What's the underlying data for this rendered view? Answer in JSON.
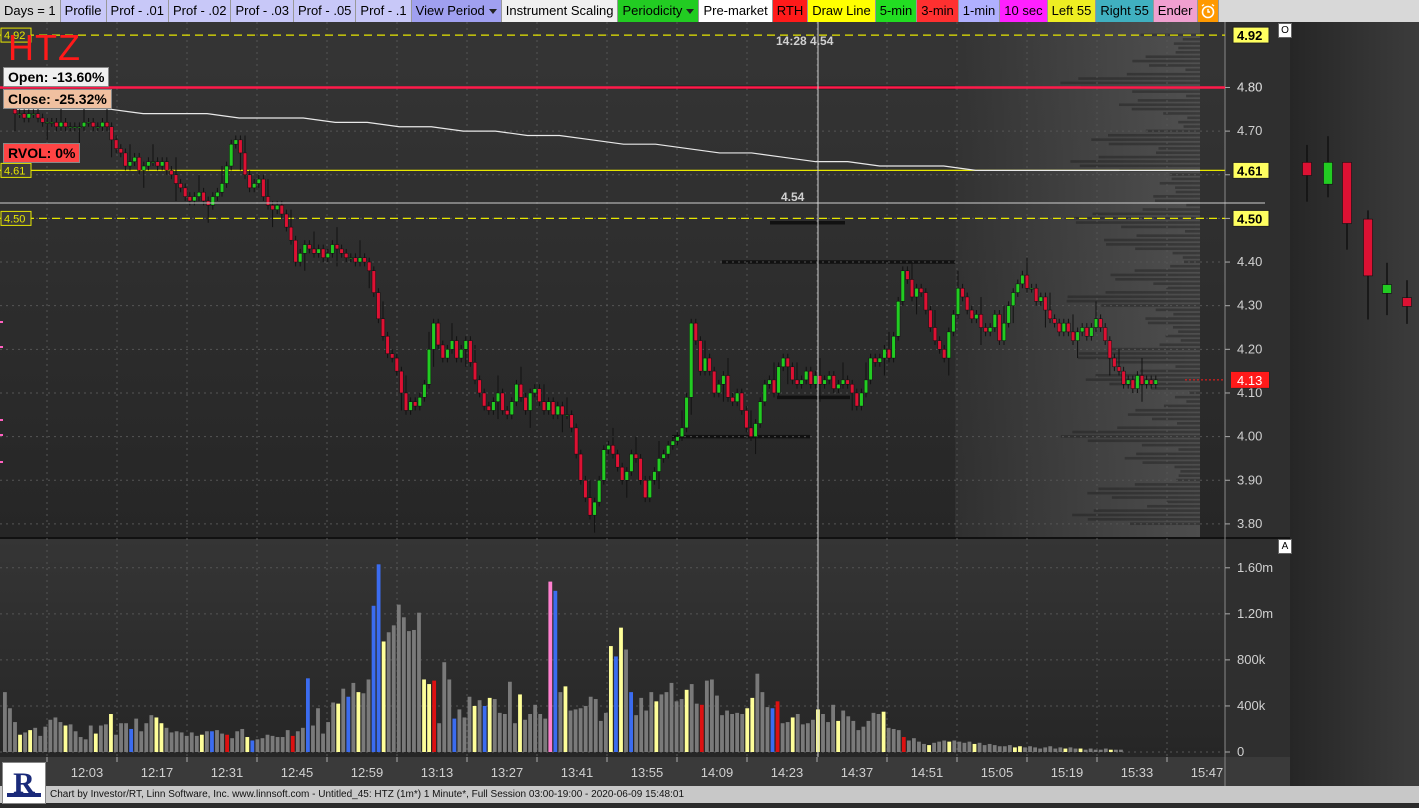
{
  "toolbar": [
    {
      "label": "Days = 1",
      "bg": "#d8d8d8",
      "fg": "#000"
    },
    {
      "label": "Profile",
      "bg": "#c8c8f8",
      "fg": "#000"
    },
    {
      "label": "Prof - .01",
      "bg": "#c8c8f8",
      "fg": "#000"
    },
    {
      "label": "Prof - .02",
      "bg": "#c8c8f8",
      "fg": "#000"
    },
    {
      "label": "Prof - .03",
      "bg": "#c8c8f8",
      "fg": "#000"
    },
    {
      "label": "Prof - .05",
      "bg": "#c8c8f8",
      "fg": "#000"
    },
    {
      "label": "Prof - .1",
      "bg": "#c8c8f8",
      "fg": "#000"
    },
    {
      "label": "View Period",
      "bg": "#a0a0f0",
      "fg": "#000",
      "dropdown": true
    },
    {
      "label": "Instrument Scaling",
      "bg": "#f0f0f0",
      "fg": "#000"
    },
    {
      "label": "Periodicity",
      "bg": "#22cc22",
      "fg": "#000",
      "dropdown": true
    },
    {
      "label": "Pre-market",
      "bg": "#ffffff",
      "fg": "#000"
    },
    {
      "label": "RTH",
      "bg": "#ff1a1a",
      "fg": "#000"
    },
    {
      "label": "Draw Line",
      "bg": "#ffff00",
      "fg": "#000"
    },
    {
      "label": "5-min",
      "bg": "#22dd22",
      "fg": "#000"
    },
    {
      "label": "3-min",
      "bg": "#ff3030",
      "fg": "#000"
    },
    {
      "label": "1-min",
      "bg": "#b0b0ff",
      "fg": "#000"
    },
    {
      "label": "10 sec",
      "bg": "#ff20ff",
      "fg": "#000"
    },
    {
      "label": "Left 55",
      "bg": "#eeee22",
      "fg": "#000"
    },
    {
      "label": "Right 55",
      "bg": "#40b0c0",
      "fg": "#000"
    },
    {
      "label": "Ender",
      "bg": "#f0a0d0",
      "fg": "#000"
    }
  ],
  "symbol": "HTZ",
  "open_label": "Open: -13.60%",
  "close_label": "Close: -25.32%",
  "rvol_label": "RVOL: 0%",
  "crosshair_label": "14:28  4.54",
  "crosshair_price": "4.54",
  "pane_letters": {
    "price": "O",
    "volume": "A"
  },
  "footer": "Chart by Investor/RT, Linn Software, Inc. www.linnsoft.com - Untitled_45: HTZ (1m*) 1 Minute*, Full Session 03:00-19:00 - 2020-06-09 15:48:01",
  "colors": {
    "up": "#22cc22",
    "down": "#dd1133",
    "vol_gray": "#7a7a7a",
    "vol_blue": "#3b6cf0",
    "vol_red": "#dd1111",
    "vol_yellow": "#ffff99",
    "vol_pink": "#ff80d0",
    "hline_red": "#ff1a4a",
    "hline_yellow": "#e6e600",
    "vwap": "#e8e8e8"
  },
  "chart_data": {
    "type": "candlestick",
    "price_axis": {
      "ticks": [
        "4.80",
        "4.70",
        "4.60",
        "4.50",
        "4.40",
        "4.30",
        "4.20",
        "4.10",
        "4.00",
        "3.90",
        "3.80"
      ],
      "range": [
        3.77,
        4.95
      ]
    },
    "volume_axis": {
      "ticks": [
        "1.60m",
        "1.20m",
        "800k",
        "400k",
        "0"
      ],
      "range": [
        0,
        1850000
      ]
    },
    "time_axis": [
      "12:03",
      "12:17",
      "12:31",
      "12:45",
      "12:59",
      "13:13",
      "13:27",
      "13:41",
      "13:55",
      "14:09",
      "14:23",
      "14:37",
      "14:51",
      "15:05",
      "15:19",
      "15:33",
      "15:47"
    ],
    "price_labels": [
      {
        "value": "4.92",
        "color": "#ffff60",
        "style": "dashed"
      },
      {
        "value": "4.80",
        "color": "#ff1a4a",
        "style": "solid"
      },
      {
        "value": "4.61",
        "color": "#ffff60",
        "style": "solid"
      },
      {
        "value": "4.50",
        "color": "#ffff60",
        "style": "dashed"
      },
      {
        "value": "4.13",
        "color": "#ff1a1a",
        "style": "dotted"
      }
    ],
    "left_labels": [
      "4.92",
      "4.61",
      "4.50"
    ],
    "last_price": "4.13",
    "candles_start": "12:03",
    "closes": [
      4.74,
      4.74,
      4.73,
      4.74,
      4.74,
      4.73,
      4.72,
      4.72,
      4.72,
      4.71,
      4.72,
      4.71,
      4.71,
      4.71,
      4.71,
      4.72,
      4.72,
      4.71,
      4.71,
      4.72,
      4.71,
      4.68,
      4.66,
      4.65,
      4.62,
      4.63,
      4.64,
      4.61,
      4.62,
      4.63,
      4.63,
      4.62,
      4.63,
      4.61,
      4.6,
      4.58,
      4.57,
      4.55,
      4.54,
      4.55,
      4.56,
      4.54,
      4.53,
      4.55,
      4.56,
      4.58,
      4.62,
      4.67,
      4.68,
      4.65,
      4.6,
      4.57,
      4.58,
      4.59,
      4.55,
      4.53,
      4.52,
      4.53,
      4.51,
      4.48,
      4.45,
      4.4,
      4.42,
      4.44,
      4.43,
      4.42,
      4.43,
      4.41,
      4.42,
      4.44,
      4.43,
      4.42,
      4.41,
      4.41,
      4.4,
      4.41,
      4.4,
      4.38,
      4.33,
      4.27,
      4.23,
      4.19,
      4.18,
      4.15,
      4.1,
      4.06,
      4.08,
      4.07,
      4.09,
      4.12,
      4.2,
      4.26,
      4.21,
      4.18,
      4.2,
      4.22,
      4.18,
      4.2,
      4.22,
      4.17,
      4.13,
      4.1,
      4.07,
      4.06,
      4.08,
      4.1,
      4.06,
      4.05,
      4.08,
      4.12,
      4.09,
      4.06,
      4.1,
      4.11,
      4.08,
      4.06,
      4.08,
      4.05,
      4.07,
      4.05,
      4.05,
      4.02,
      3.96,
      3.9,
      3.86,
      3.82,
      3.85,
      3.9,
      3.97,
      3.98,
      3.96,
      3.93,
      3.9,
      3.92,
      3.96,
      3.95,
      3.9,
      3.86,
      3.9,
      3.92,
      3.95,
      3.96,
      3.98,
      3.99,
      4.0,
      4.02,
      4.09,
      4.26,
      4.22,
      4.15,
      4.18,
      4.15,
      4.1,
      4.12,
      4.14,
      4.09,
      4.08,
      4.1,
      4.06,
      4.02,
      4.0,
      4.03,
      4.08,
      4.12,
      4.13,
      4.1,
      4.16,
      4.18,
      4.16,
      4.13,
      4.12,
      4.13,
      4.15,
      4.12,
      4.14,
      4.12,
      4.13,
      4.14,
      4.11,
      4.12,
      4.13,
      4.12,
      4.1,
      4.07,
      4.1,
      4.13,
      4.18,
      4.17,
      4.18,
      4.2,
      4.18,
      4.23,
      4.31,
      4.38,
      4.36,
      4.32,
      4.34,
      4.33,
      4.29,
      4.25,
      4.22,
      4.2,
      4.18,
      4.24,
      4.28,
      4.34,
      4.32,
      4.29,
      4.27,
      4.28,
      4.25,
      4.24,
      4.25,
      4.28,
      4.22,
      4.26,
      4.3,
      4.33,
      4.35,
      4.37,
      4.34,
      4.34,
      4.31,
      4.32,
      4.29,
      4.27,
      4.26,
      4.24,
      4.26,
      4.24,
      4.22,
      4.24,
      4.25,
      4.23,
      4.25,
      4.27,
      4.25,
      4.22,
      4.18,
      4.16,
      4.15,
      4.12,
      4.13,
      4.11,
      4.14,
      4.12,
      4.13,
      4.12,
      4.13
    ],
    "vwap": [
      4.75,
      4.75,
      4.75,
      4.75,
      4.74,
      4.74,
      4.74,
      4.73,
      4.73,
      4.73,
      4.72,
      4.72,
      4.71,
      4.71,
      4.7,
      4.7,
      4.69,
      4.69,
      4.68,
      4.67,
      4.67,
      4.66,
      4.65,
      4.65,
      4.64,
      4.63,
      4.63,
      4.62,
      4.62,
      4.62,
      4.61,
      4.61,
      4.61,
      4.61,
      4.61,
      4.61,
      4.61,
      4.61
    ],
    "volume": [
      520,
      380,
      260,
      150,
      170,
      190,
      210,
      140,
      220,
      280,
      300,
      260,
      230,
      240,
      180,
      130,
      110,
      230,
      160,
      230,
      240,
      330,
      150,
      250,
      250,
      200,
      290,
      180,
      250,
      320,
      300,
      250,
      210,
      170,
      180,
      170,
      140,
      170,
      140,
      150,
      180,
      180,
      190,
      160,
      150,
      120,
      180,
      200,
      130,
      100,
      110,
      120,
      150,
      140,
      130,
      130,
      190,
      140,
      180,
      210,
      640,
      230,
      380,
      160,
      260,
      430,
      420,
      550,
      480,
      600,
      520,
      510,
      630,
      1270,
      1630,
      960,
      1040,
      1100,
      1280,
      1170,
      1050,
      1060,
      1210,
      630,
      590,
      620,
      250,
      780,
      630,
      290,
      370,
      300,
      480,
      400,
      450,
      400,
      470,
      460,
      340,
      330,
      610,
      250,
      500,
      280,
      330,
      410,
      330,
      290,
      1480,
      1400,
      520,
      570,
      360,
      370,
      380,
      400,
      480,
      460,
      270,
      340,
      920,
      830,
      1080,
      890,
      520,
      320,
      470,
      360,
      520,
      440,
      500,
      520,
      600,
      440,
      460,
      540,
      590,
      420,
      410,
      620,
      630,
      490,
      320,
      360,
      330,
      340,
      330,
      380,
      470,
      680,
      520,
      390,
      380,
      440,
      250,
      260,
      300,
      330,
      240,
      250,
      280,
      370,
      330,
      260,
      410,
      270,
      360,
      310,
      270,
      190,
      220,
      270,
      340,
      330,
      350,
      210,
      200,
      190,
      130,
      100,
      120,
      90,
      70,
      60,
      80,
      90,
      100,
      90,
      100,
      90,
      80,
      90,
      70,
      80,
      60,
      70,
      60,
      50,
      50,
      60,
      40,
      50,
      40,
      50,
      40,
      30,
      40,
      50,
      30,
      40,
      30,
      40,
      30,
      30,
      20,
      30,
      20,
      20,
      30,
      20,
      20,
      20
    ]
  }
}
